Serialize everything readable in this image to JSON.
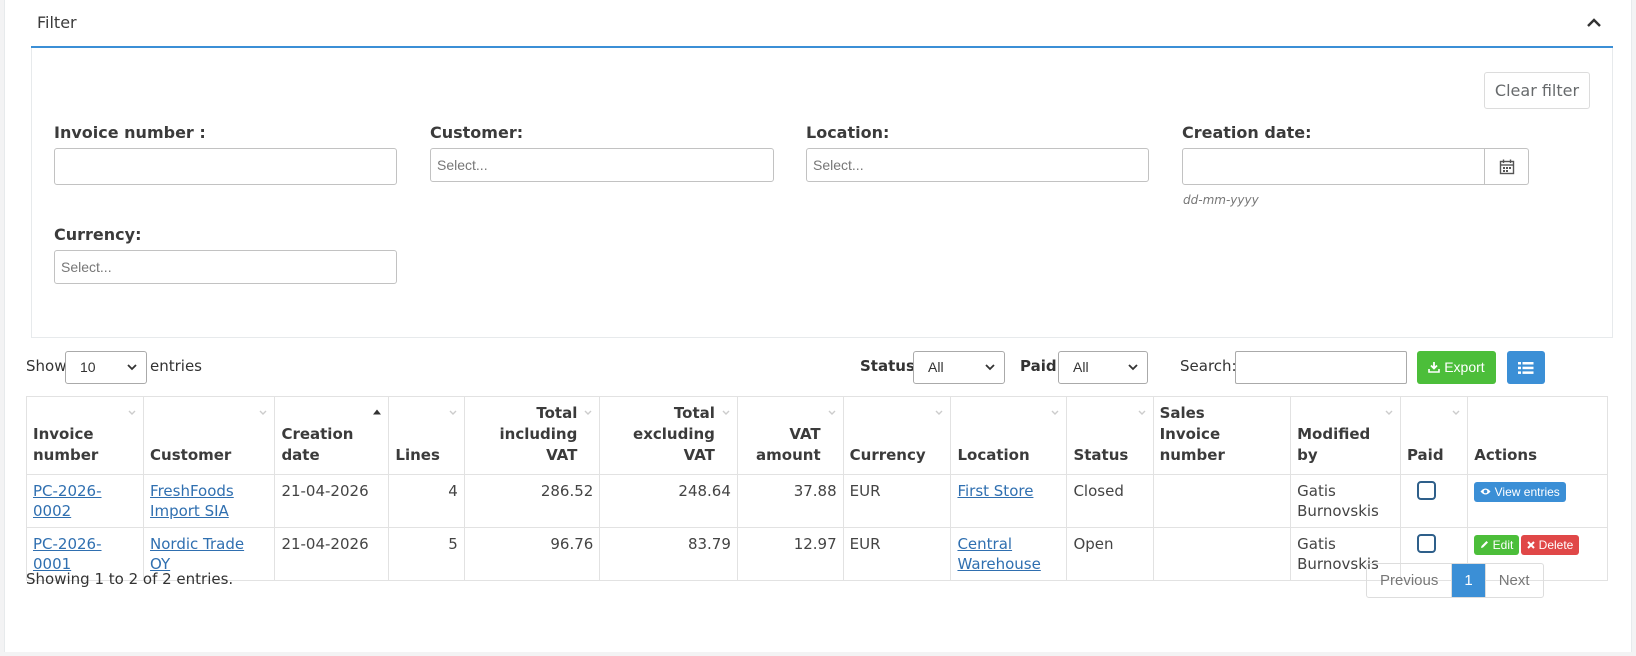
{
  "filter": {
    "title": "Filter",
    "clear_label": "Clear filter",
    "fields": {
      "invoice_number": {
        "label": "Invoice number :",
        "value": ""
      },
      "customer": {
        "label": "Customer:",
        "placeholder": "Select..."
      },
      "location": {
        "label": "Location:",
        "placeholder": "Select..."
      },
      "creation_date": {
        "label": "Creation date:",
        "value": "",
        "hint": "dd-mm-yyyy"
      },
      "currency": {
        "label": "Currency:",
        "placeholder": "Select..."
      }
    }
  },
  "toolbar": {
    "show_label": "Show",
    "entries_label": "entries",
    "page_size": "10",
    "status_label": "Status:",
    "status_value": "All",
    "paid_label": "Paid:",
    "paid_value": "All",
    "search_label": "Search:",
    "search_value": "",
    "export_label": "Export"
  },
  "table": {
    "columns": [
      {
        "line1": "Invoice",
        "line2": "number"
      },
      {
        "line1": "",
        "line2": "Customer"
      },
      {
        "line1": "Creation",
        "line2": "date"
      },
      {
        "line1": "",
        "line2": "Lines"
      },
      {
        "line1": "Total",
        "line2": "including VAT"
      },
      {
        "line1": "Total",
        "line2": "excluding VAT"
      },
      {
        "line1": "VAT",
        "line2": "amount"
      },
      {
        "line1": "",
        "line2": "Currency"
      },
      {
        "line1": "",
        "line2": "Location"
      },
      {
        "line1": "",
        "line2": "Status"
      },
      {
        "line1": "Sales Invoice",
        "line2": "number"
      },
      {
        "line1": "Modified",
        "line2": "by"
      },
      {
        "line1": "",
        "line2": "Paid"
      },
      {
        "line1": "",
        "line2": "Actions"
      }
    ],
    "rows": [
      {
        "invoice_number": "PC-2026-0002",
        "customer": "FreshFoods Import SIA",
        "creation_date": "21-04-2026",
        "lines": "4",
        "total_incl": "286.52",
        "total_excl": "248.64",
        "vat": "37.88",
        "currency": "EUR",
        "location": "First Store",
        "status": "Closed",
        "sales_invoice": "",
        "modified_by": "Gatis Burnovskis",
        "paid": false,
        "actions": {
          "view": "View entries"
        }
      },
      {
        "invoice_number": "PC-2026-0001",
        "customer": "Nordic Trade OY",
        "creation_date": "21-04-2026",
        "lines": "5",
        "total_incl": "96.76",
        "total_excl": "83.79",
        "vat": "12.97",
        "currency": "EUR",
        "location": "Central Warehouse",
        "status": "Open",
        "sales_invoice": "",
        "modified_by": "Gatis Burnovskis",
        "paid": false,
        "actions": {
          "edit": "Edit",
          "delete": "Delete"
        }
      }
    ]
  },
  "footer": {
    "info": "Showing 1 to 2 of 2 entries.",
    "previous": "Previous",
    "current_page": "1",
    "next": "Next"
  },
  "colors": {
    "accent": "#3b8fd6",
    "success": "#4cbe3a",
    "danger": "#e04848",
    "link": "#2f6fb0"
  },
  "icons": [
    "chevron-up-icon",
    "calendar-icon",
    "chevron-down-icon",
    "download-icon",
    "list-icon",
    "eye-icon",
    "pencil-icon",
    "times-icon",
    "sort-icon"
  ]
}
